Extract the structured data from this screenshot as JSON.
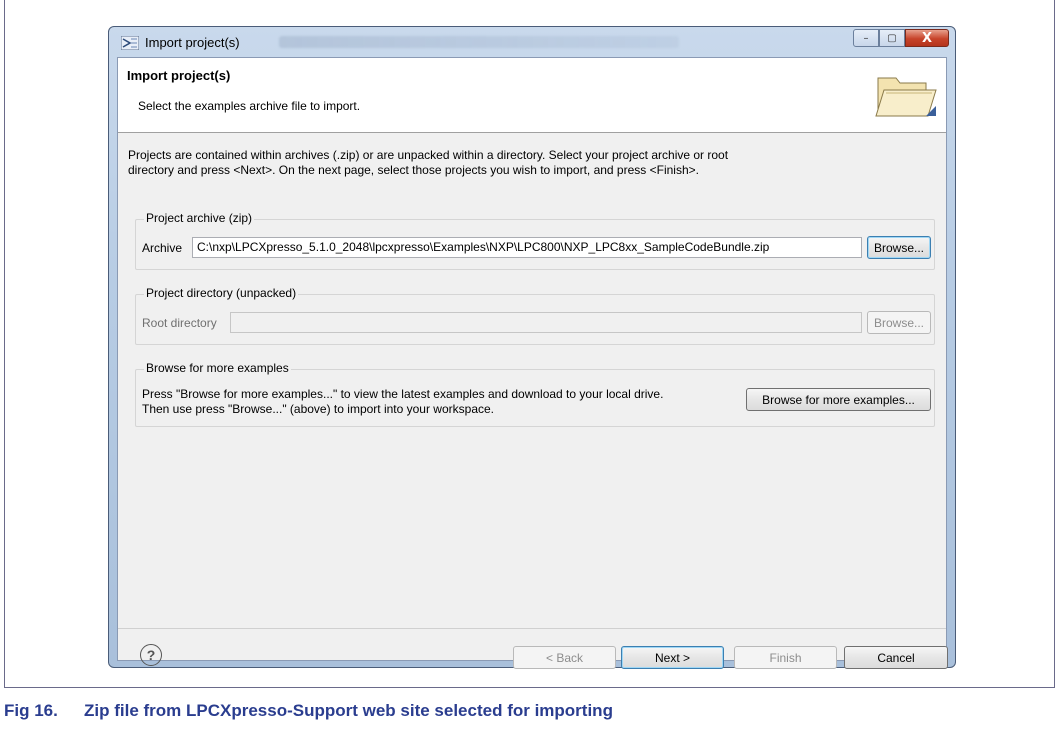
{
  "window": {
    "title": "Import project(s)",
    "controls": {
      "minimize": "–",
      "maximize": "▢",
      "close": "X"
    }
  },
  "banner": {
    "title": "Import project(s)",
    "message": "Select the examples archive file to import.",
    "icon": "open-folder-icon"
  },
  "intro": "Projects are contained within archives (.zip) or are unpacked within a directory. Select your project archive or root directory and press <Next>. On the next page, select those projects you wish to import, and press <Finish>.",
  "archive_group": {
    "legend": "Project archive (zip)",
    "label": "Archive",
    "value": "C:\\nxp\\LPCXpresso_5.1.0_2048\\lpcxpresso\\Examples\\NXP\\LPC800\\NXP_LPC8xx_SampleCodeBundle.zip",
    "browse": "Browse..."
  },
  "directory_group": {
    "legend": "Project directory (unpacked)",
    "label": "Root directory",
    "value": "",
    "browse": "Browse..."
  },
  "more_group": {
    "legend": "Browse for more examples",
    "text_line1": "Press \"Browse for more examples...\" to view the latest examples and download to your local drive.",
    "text_line2": "Then use press \"Browse...\" (above) to import into your workspace.",
    "button": "Browse for more examples..."
  },
  "footer": {
    "help_icon": "?",
    "back": "< Back",
    "next": "Next >",
    "finish": "Finish",
    "cancel": "Cancel"
  },
  "caption": {
    "number": "Fig 16.",
    "text": "Zip file from LPCXpresso-Support web site selected for importing"
  }
}
